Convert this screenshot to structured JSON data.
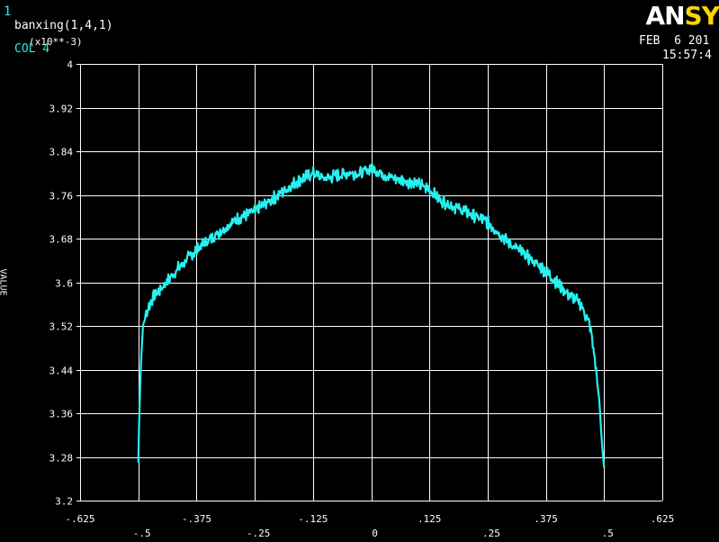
{
  "header": {
    "window_number": "1",
    "plot_title": "banxing(1,4,1)",
    "y_multiplier": "(x10**-3)",
    "curve_label": "COL 4",
    "logo_white": "AN",
    "logo_yellow": "SY",
    "date": "FEB  6 201",
    "time": "15:57:4",
    "y_axis_label": "VALUE"
  },
  "colors": {
    "background": "#000000",
    "grid": "#ffffff",
    "curve": "#27f0f0",
    "label_cyan": "#2ee6e6",
    "logo_yellow": "#ffd400"
  },
  "chart_data": {
    "type": "line",
    "title": "banxing(1,4,1)",
    "xlim": [
      -0.625,
      0.625
    ],
    "ylim": [
      3.2,
      4.0
    ],
    "y_scale_note": "(x10**-3)",
    "grid": true,
    "x_ticks": [
      -0.625,
      -0.5,
      -0.375,
      -0.25,
      -0.125,
      0,
      0.125,
      0.25,
      0.375,
      0.5,
      0.625
    ],
    "x_tick_labels_top": [
      "-.625",
      "-.375",
      "-.125",
      ".125",
      ".375",
      ".625"
    ],
    "x_tick_labels_bottom": [
      "-.5",
      "-.25",
      "0",
      ".25",
      ".5"
    ],
    "y_ticks": [
      "3.2",
      "3.28",
      "3.36",
      "3.44",
      "3.52",
      "3.6",
      "3.68",
      "3.76",
      "3.84",
      "3.92",
      "4"
    ],
    "y_tick_values": [
      3.2,
      3.28,
      3.36,
      3.44,
      3.52,
      3.6,
      3.68,
      3.76,
      3.84,
      3.92,
      4.0
    ],
    "series": [
      {
        "name": "COL 4",
        "x": [
          -0.5,
          -0.498,
          -0.495,
          -0.49,
          -0.48,
          -0.47,
          -0.45,
          -0.42,
          -0.375,
          -0.33,
          -0.28,
          -0.25,
          -0.2,
          -0.15,
          -0.125,
          -0.1,
          -0.05,
          -0.02,
          0,
          0.02,
          0.05,
          0.1,
          0.125,
          0.15,
          0.2,
          0.25,
          0.3,
          0.33,
          0.375,
          0.42,
          0.45,
          0.47,
          0.48,
          0.49,
          0.495,
          0.5
        ],
        "y": [
          3.27,
          3.35,
          3.44,
          3.52,
          3.55,
          3.57,
          3.59,
          3.62,
          3.66,
          3.69,
          3.72,
          3.73,
          3.76,
          3.79,
          3.8,
          3.79,
          3.8,
          3.8,
          3.81,
          3.8,
          3.79,
          3.78,
          3.77,
          3.75,
          3.73,
          3.71,
          3.67,
          3.65,
          3.62,
          3.58,
          3.56,
          3.52,
          3.46,
          3.38,
          3.31,
          3.26
        ]
      }
    ]
  }
}
